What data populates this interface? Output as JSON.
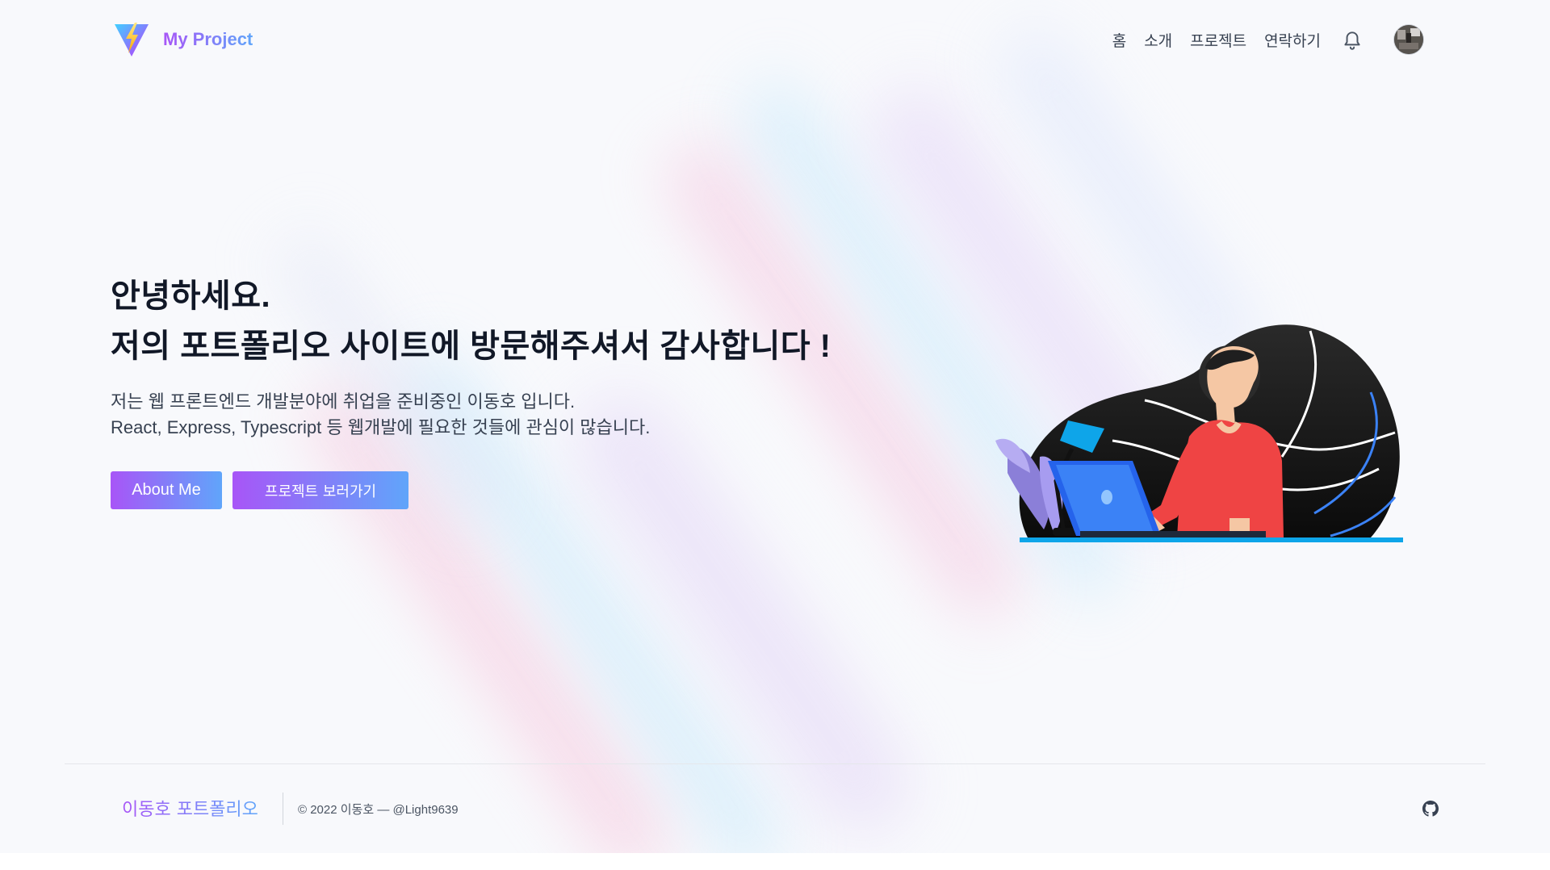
{
  "header": {
    "logo_text": "My Project",
    "nav": [
      "홈",
      "소개",
      "프로젝트",
      "연락하기"
    ]
  },
  "hero": {
    "title_line1": "안녕하세요.",
    "title_line2": "저의 포트폴리오 사이트에 방문해주셔서 감사합니다 !",
    "desc_line1": "저는 웹 프론트엔드 개발분야에 취업을 준비중인 이동호 입니다.",
    "desc_line2": "React, Express, Typescript 등 웹개발에 필요한 것들에 관심이 많습니다.",
    "btn_about": "About Me",
    "btn_projects": "프로젝트 보러가기"
  },
  "footer": {
    "brand": "이동호 포트폴리오",
    "copyright": "© 2022 이동호 — @Light9639"
  },
  "icons": {
    "logo": "vite-logo-icon",
    "bell": "bell-icon",
    "avatar": "avatar",
    "github": "github-icon",
    "illustration": "person-laptop-illustration"
  },
  "colors": {
    "accent_start": "#a855f7",
    "accent_end": "#60a5fa",
    "text": "#111827",
    "shirt": "#ef4444",
    "laptop": "#2563eb"
  }
}
